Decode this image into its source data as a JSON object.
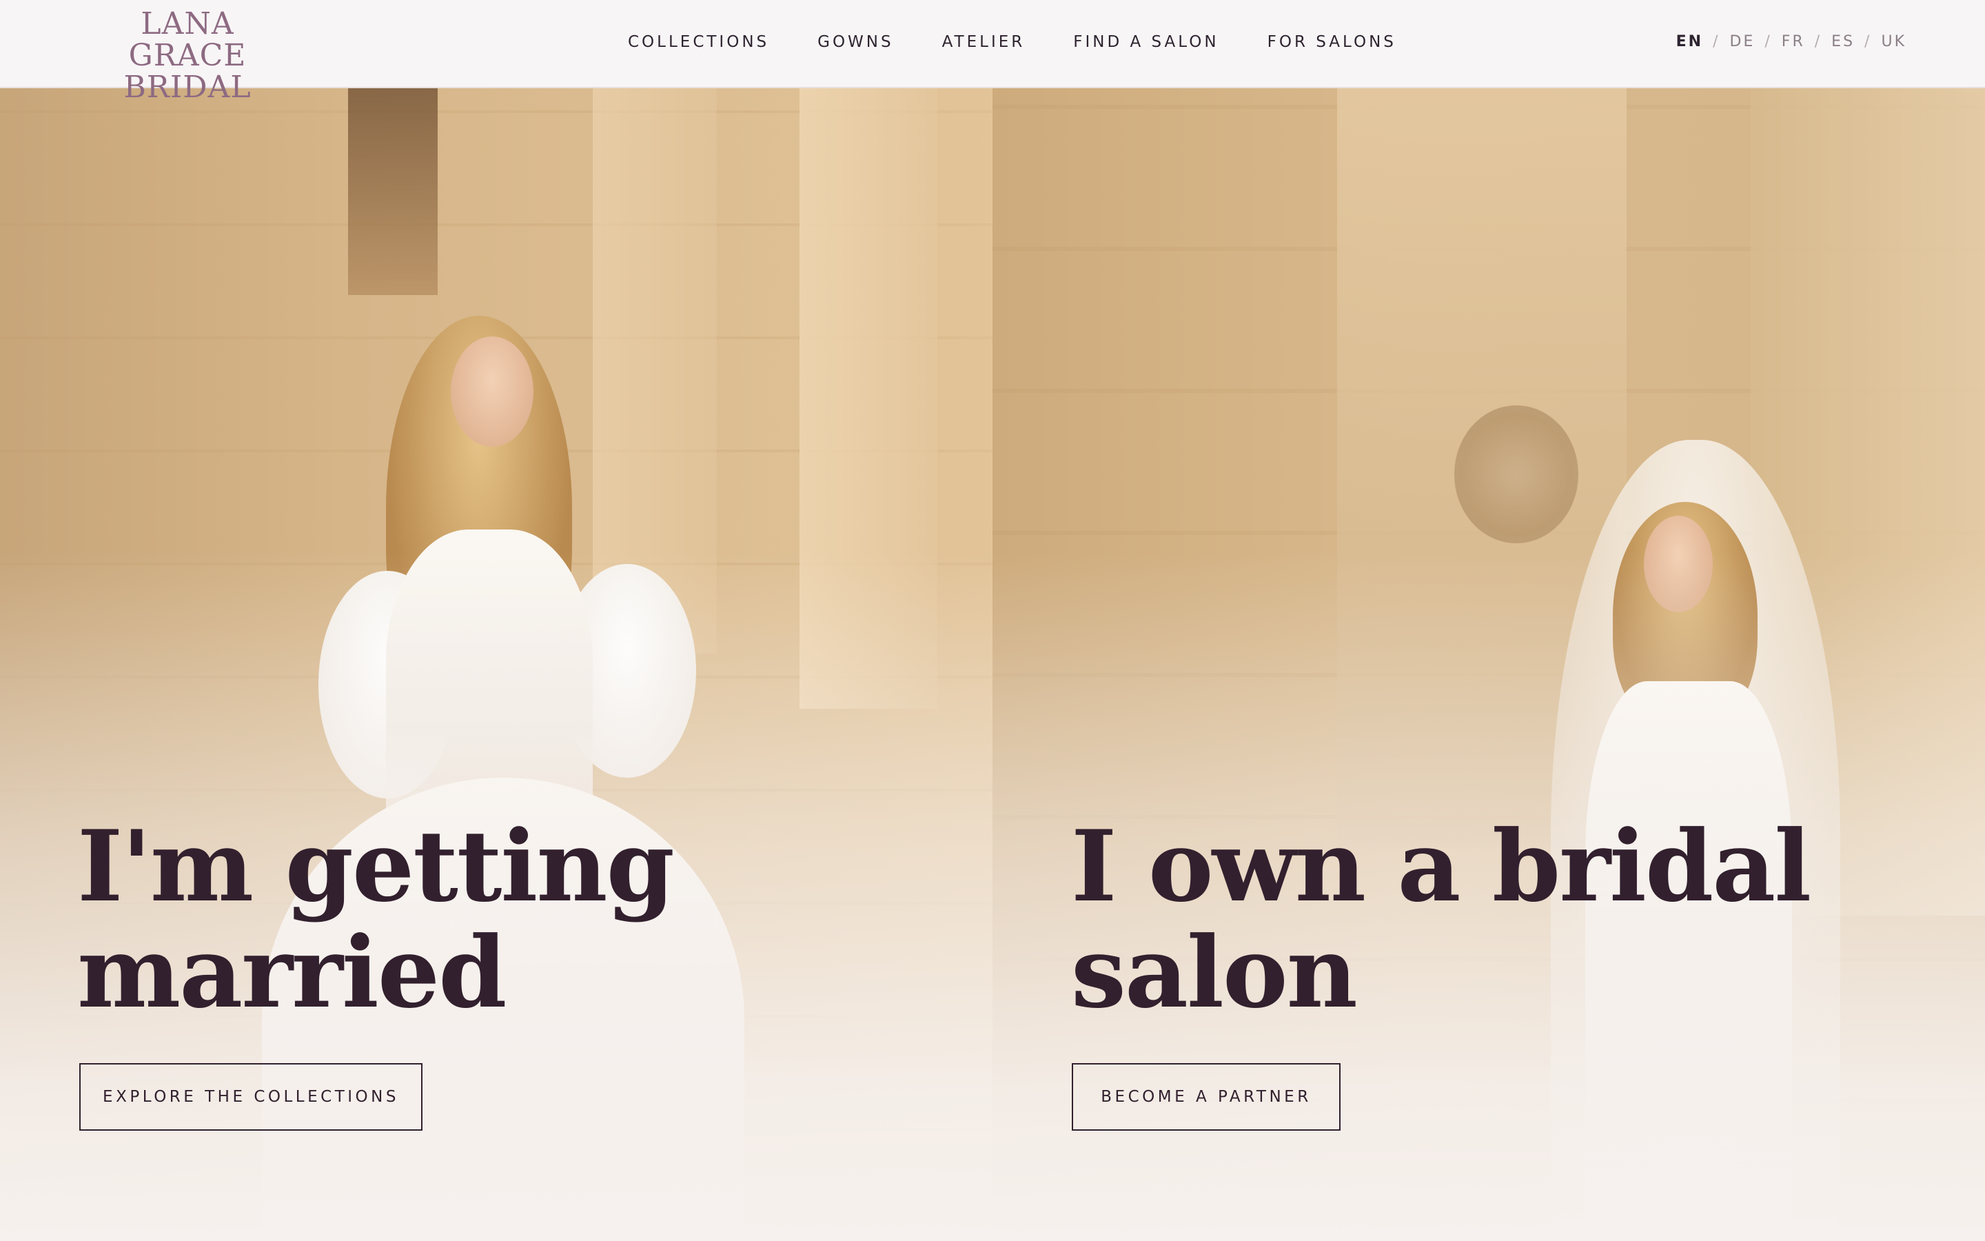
{
  "logo": {
    "line1": "LANA GRACE",
    "line2": "BRIDAL"
  },
  "nav": {
    "items": [
      {
        "label": "COLLECTIONS"
      },
      {
        "label": "GOWNS"
      },
      {
        "label": "ATELIER"
      },
      {
        "label": "FIND A SALON"
      },
      {
        "label": "FOR SALONS"
      }
    ]
  },
  "languages": {
    "active": "EN",
    "items": [
      "EN",
      "DE",
      "FR",
      "ES",
      "UK"
    ],
    "separator": "/"
  },
  "hero": {
    "left": {
      "heading_line1": "I'm getting",
      "heading_line2": "married",
      "button": "EXPLORE THE COLLECTIONS"
    },
    "right": {
      "heading_line1": "I own a bridal",
      "heading_line2": "salon",
      "button": "BECOME A PARTNER"
    }
  },
  "colors": {
    "logo": "#8d6a82",
    "text_dark": "#32202e",
    "header_bg": "#f8f5f6",
    "stone": "#d8b98f"
  }
}
